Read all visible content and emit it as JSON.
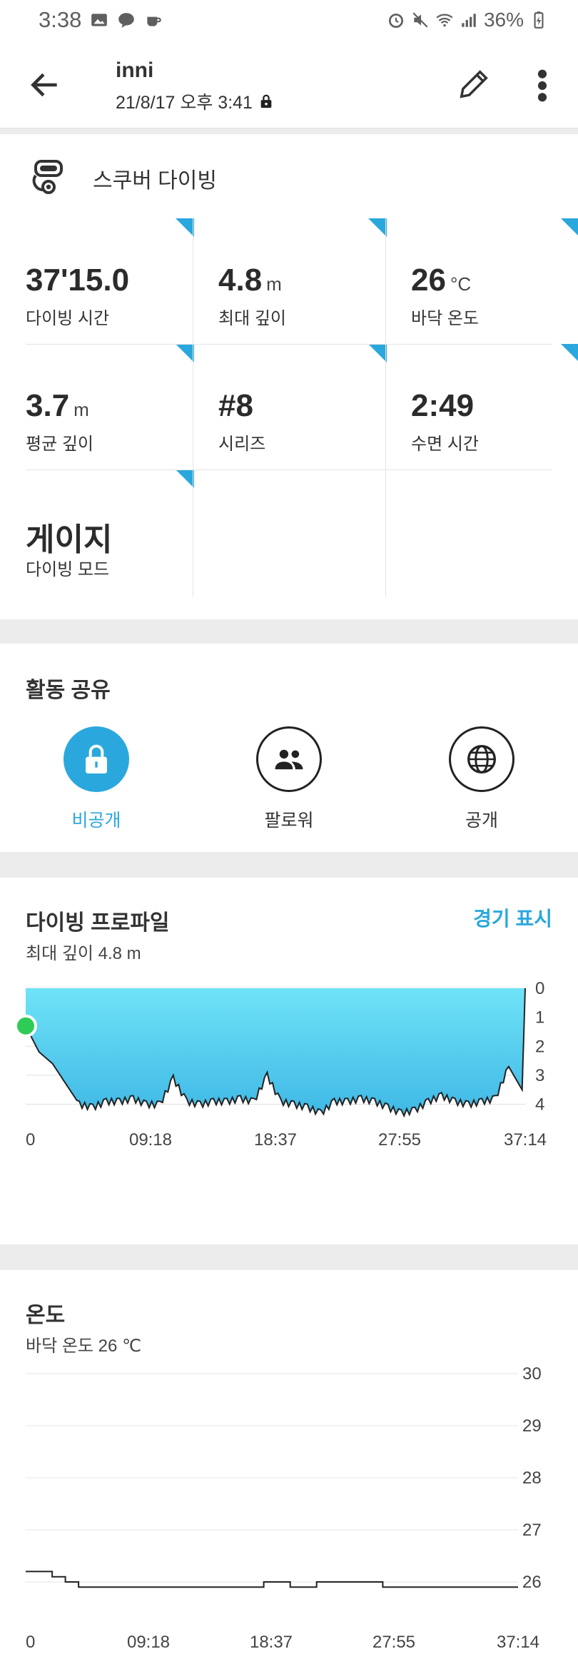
{
  "status_bar": {
    "time": "3:38",
    "battery": "36%"
  },
  "header": {
    "title": "inni",
    "subtitle": "21/8/17 오후 3:41"
  },
  "summary": {
    "activity": "스쿠버 다이빙",
    "stats": [
      {
        "value": "37'15.0",
        "unit": "",
        "label": "다이빙 시간"
      },
      {
        "value": "4.8",
        "unit": "m",
        "label": "최대 깊이"
      },
      {
        "value": "26",
        "unit": "°C",
        "label": "바닥 온도"
      },
      {
        "value": "3.7",
        "unit": "m",
        "label": "평균 깊이"
      },
      {
        "value": "#8",
        "unit": "",
        "label": "시리즈"
      },
      {
        "value": "2:49",
        "unit": "",
        "label": "수면 시간"
      },
      {
        "value": "게이지",
        "unit": "",
        "label": "다이빙 모드"
      }
    ]
  },
  "share": {
    "title": "활동 공유",
    "options": [
      {
        "label": "비공개",
        "icon": "lock-icon",
        "selected": true
      },
      {
        "label": "팔로워",
        "icon": "people-icon",
        "selected": false
      },
      {
        "label": "공개",
        "icon": "globe-icon",
        "selected": false
      }
    ],
    "accent": "#2aa8dd"
  },
  "profile": {
    "title": "다이빙 프로파일",
    "subtitle": "최대 깊이 4.8 m",
    "warning_link": "경기 표시"
  },
  "temperature": {
    "title": "온도",
    "subtitle": "바닥 온도 26 ℃"
  },
  "chart_data": [
    {
      "type": "area",
      "xlabel": "",
      "ylabel": "",
      "x_ticks": [
        "0",
        "09:18",
        "18:37",
        "27:55",
        "37:14"
      ],
      "y_ticks": [
        "0",
        "1",
        "2",
        "3",
        "4"
      ],
      "ylim": [
        0,
        4.8
      ],
      "inverted_y": true,
      "series": [
        {
          "x_min": [
            0,
            1,
            2,
            3,
            4,
            5,
            6,
            7,
            8,
            9,
            10,
            11,
            12,
            13,
            14,
            15,
            16,
            17,
            18,
            19,
            20,
            21,
            22,
            23,
            24,
            25,
            26,
            27,
            28,
            29,
            30,
            31,
            32,
            33,
            34,
            35,
            36,
            37,
            37.23
          ],
          "depth_m": [
            1.3,
            2.2,
            2.6,
            3.3,
            4.0,
            4.1,
            3.9,
            3.9,
            3.8,
            4.0,
            4.0,
            3.1,
            3.9,
            4.0,
            3.9,
            3.9,
            3.8,
            3.9,
            3.0,
            3.9,
            4.0,
            4.1,
            4.3,
            3.9,
            3.9,
            3.8,
            3.9,
            4.1,
            4.3,
            4.2,
            3.9,
            3.7,
            3.9,
            4.0,
            3.9,
            3.8,
            2.7,
            3.5,
            0.0
          ]
        }
      ]
    },
    {
      "type": "line",
      "xlabel": "",
      "ylabel": "",
      "x_ticks": [
        "0",
        "09:18",
        "18:37",
        "27:55",
        "37:14"
      ],
      "y_ticks": [
        "30",
        "29",
        "28",
        "27",
        "26"
      ],
      "ylim": [
        25.8,
        30
      ],
      "series": [
        {
          "x_min": [
            0,
            1,
            2,
            3,
            4,
            17,
            18,
            19,
            20,
            21,
            22,
            23,
            24,
            25,
            26,
            27,
            37.23
          ],
          "temp_c": [
            26.2,
            26.2,
            26.1,
            26.0,
            25.9,
            25.9,
            26.0,
            26.0,
            25.9,
            25.9,
            26.0,
            26.0,
            26.0,
            26.0,
            26.0,
            25.9,
            25.9
          ]
        }
      ]
    }
  ]
}
